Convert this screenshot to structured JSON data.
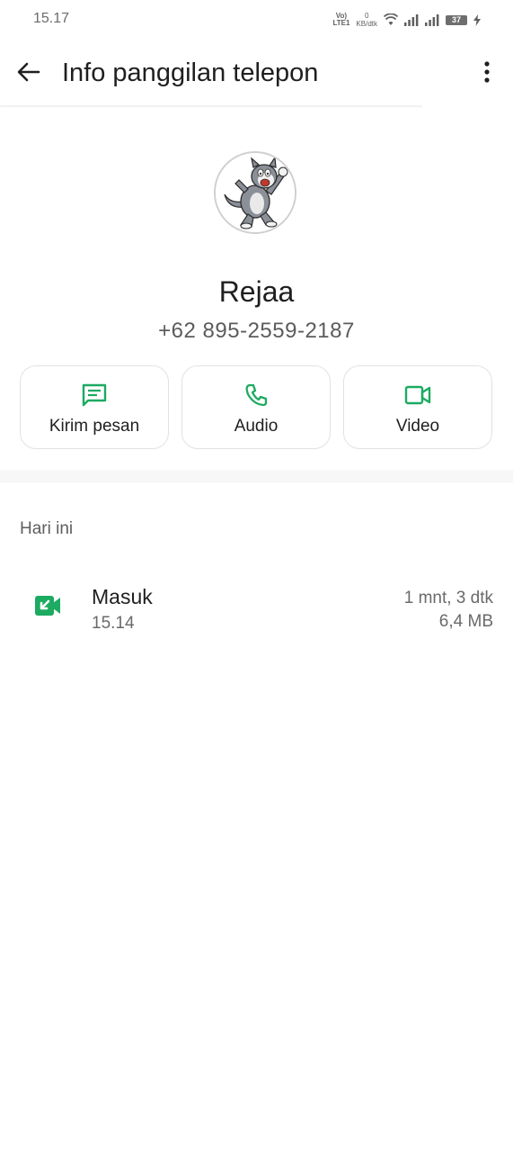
{
  "status_bar": {
    "time": "15.17",
    "volte_top": "Vo)",
    "volte_bottom": "LTE1",
    "net_speed_value": "0",
    "net_speed_unit": "KB/dtk",
    "battery_level": "37"
  },
  "header": {
    "title": "Info panggilan telepon"
  },
  "contact": {
    "name": "Rejaa",
    "phone": "+62 895-2559-2187"
  },
  "actions": [
    {
      "label": "Kirim pesan",
      "icon": "message-icon"
    },
    {
      "label": "Audio",
      "icon": "phone-icon"
    },
    {
      "label": "Video",
      "icon": "video-icon"
    }
  ],
  "call_log": {
    "section_label": "Hari ini",
    "entries": [
      {
        "type": "Masuk",
        "time": "15.14",
        "duration": "1 mnt, 3 dtk",
        "data_size": "6,4 MB",
        "icon": "incoming-video-call-icon"
      }
    ]
  },
  "colors": {
    "accent_green": "#1DAA61",
    "text_primary": "#1f1f1f",
    "text_secondary": "#6a6a6a"
  }
}
